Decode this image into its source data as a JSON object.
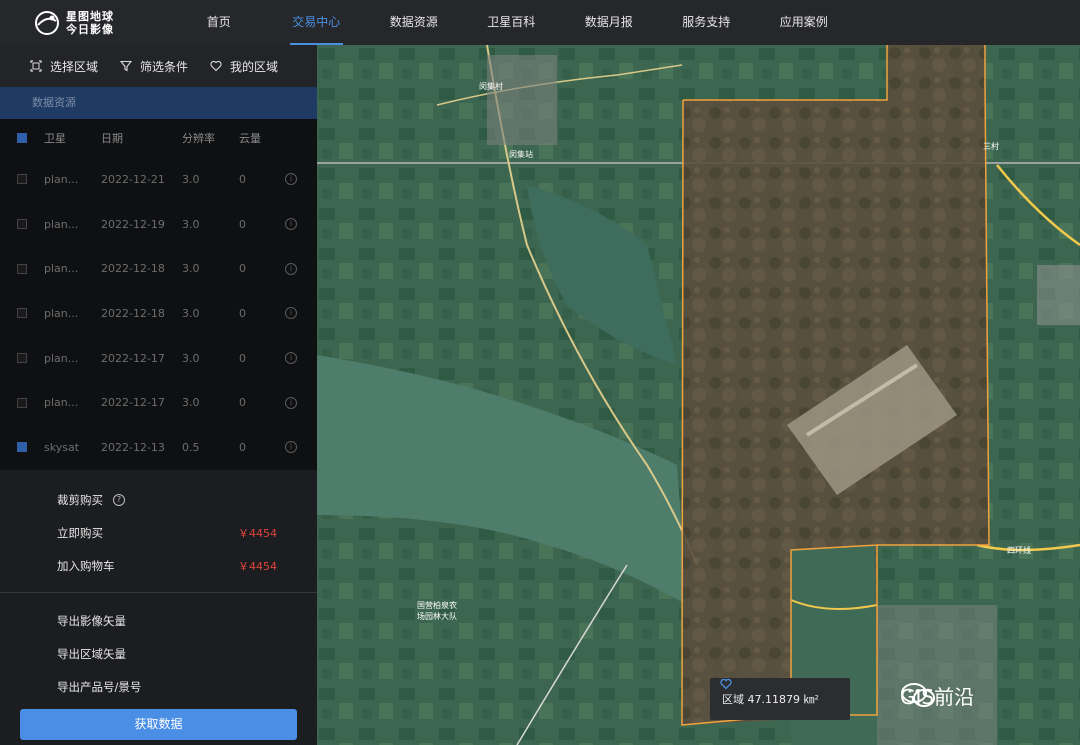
{
  "header": {
    "logo_line1": "星图地球",
    "logo_line2": "今日影像",
    "nav": [
      {
        "label": "首页"
      },
      {
        "label": "交易中心",
        "active": true
      },
      {
        "label": "数据资源"
      },
      {
        "label": "卫星百科"
      },
      {
        "label": "数据月报"
      },
      {
        "label": "服务支持"
      },
      {
        "label": "应用案例"
      }
    ]
  },
  "sidebar": {
    "tools": {
      "select_area": "选择区域",
      "filter": "筛选条件",
      "my_area": "我的区域"
    },
    "section_title": "数据资源",
    "table": {
      "headers": {
        "satellite": "卫星",
        "date": "日期",
        "resolution": "分辨率",
        "cloud": "云量"
      },
      "rows": [
        {
          "satellite": "plan...",
          "date": "2022-12-21",
          "resolution": "3.0",
          "cloud": "0",
          "checked": false
        },
        {
          "satellite": "plan...",
          "date": "2022-12-19",
          "resolution": "3.0",
          "cloud": "0",
          "checked": false
        },
        {
          "satellite": "plan...",
          "date": "2022-12-18",
          "resolution": "3.0",
          "cloud": "0",
          "checked": false
        },
        {
          "satellite": "plan...",
          "date": "2022-12-18",
          "resolution": "3.0",
          "cloud": "0",
          "checked": false
        },
        {
          "satellite": "plan...",
          "date": "2022-12-17",
          "resolution": "3.0",
          "cloud": "0",
          "checked": false
        },
        {
          "satellite": "plan...",
          "date": "2022-12-17",
          "resolution": "3.0",
          "cloud": "0",
          "checked": false
        },
        {
          "satellite": "skysat",
          "date": "2022-12-13",
          "resolution": "0.5",
          "cloud": "0",
          "checked": true
        }
      ]
    },
    "purchase": {
      "crop_buy": "裁剪购买",
      "buy_now": "立即购买",
      "buy_now_price": "￥4454",
      "add_cart": "加入购物车",
      "add_cart_price": "￥4454"
    },
    "exports": {
      "image_vector": "导出影像矢量",
      "area_vector": "导出区域矢量",
      "product_id": "导出产品号/景号"
    },
    "get_data": "获取数据"
  },
  "map": {
    "area_label": "区域 47.11879 ㎞²",
    "watermark": "GIS前沿",
    "labels": {
      "forest": "国营柏泉农\n场园林大队",
      "station": "闵集站",
      "village_top": "闵集村",
      "village_right": "三村",
      "road": "四环线"
    }
  },
  "colors": {
    "accent": "#4a90e2",
    "button": "#4a8ee6",
    "price": "#e2453c",
    "polygon": "#f0a23c"
  }
}
